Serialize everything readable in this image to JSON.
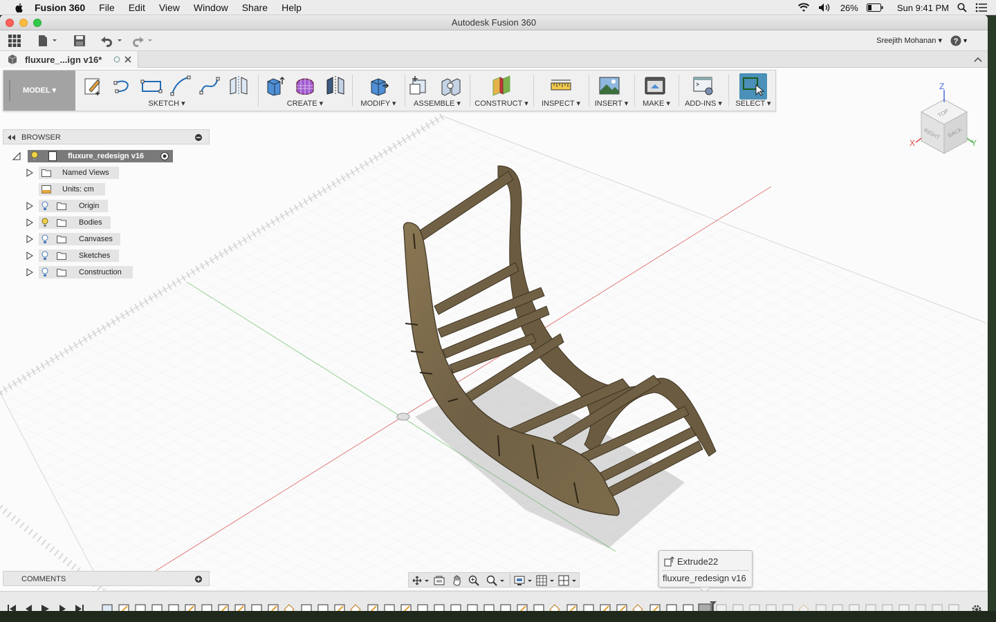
{
  "menubar": {
    "app_name": "Fusion 360",
    "items": [
      "File",
      "Edit",
      "View",
      "Window",
      "Share",
      "Help"
    ],
    "battery": "26%",
    "clock": "Sun 9:41 PM"
  },
  "window": {
    "title": "Autodesk Fusion 360",
    "user_name": "Sreejith Mohanan",
    "doc_tab": "fluxure_...ign v16*"
  },
  "toolbar": {
    "workspace": "MODEL",
    "groups": [
      "SKETCH",
      "CREATE",
      "MODIFY",
      "ASSEMBLE",
      "CONSTRUCT",
      "INSPECT",
      "INSERT",
      "MAKE",
      "ADD-INS",
      "SELECT"
    ]
  },
  "browser": {
    "title": "BROWSER",
    "root": "fluxure_redesign v16",
    "items": [
      "Named Views",
      "Units: cm",
      "Origin",
      "Bodies",
      "Canvases",
      "Sketches",
      "Construction"
    ]
  },
  "comments": {
    "title": "COMMENTS"
  },
  "viewcube": {
    "z": "Z",
    "x": "X",
    "y": "Y",
    "faces": {
      "top": "TOP",
      "right": "RIGHT",
      "back": "BACK"
    }
  },
  "tooltip": {
    "feature": "Extrude22",
    "document": "fluxure_redesign v16"
  },
  "colors": {
    "wood": "#7a6a4d",
    "toolbar_active": "#4a90b8",
    "workspace_btn": "#a3a3a3"
  }
}
